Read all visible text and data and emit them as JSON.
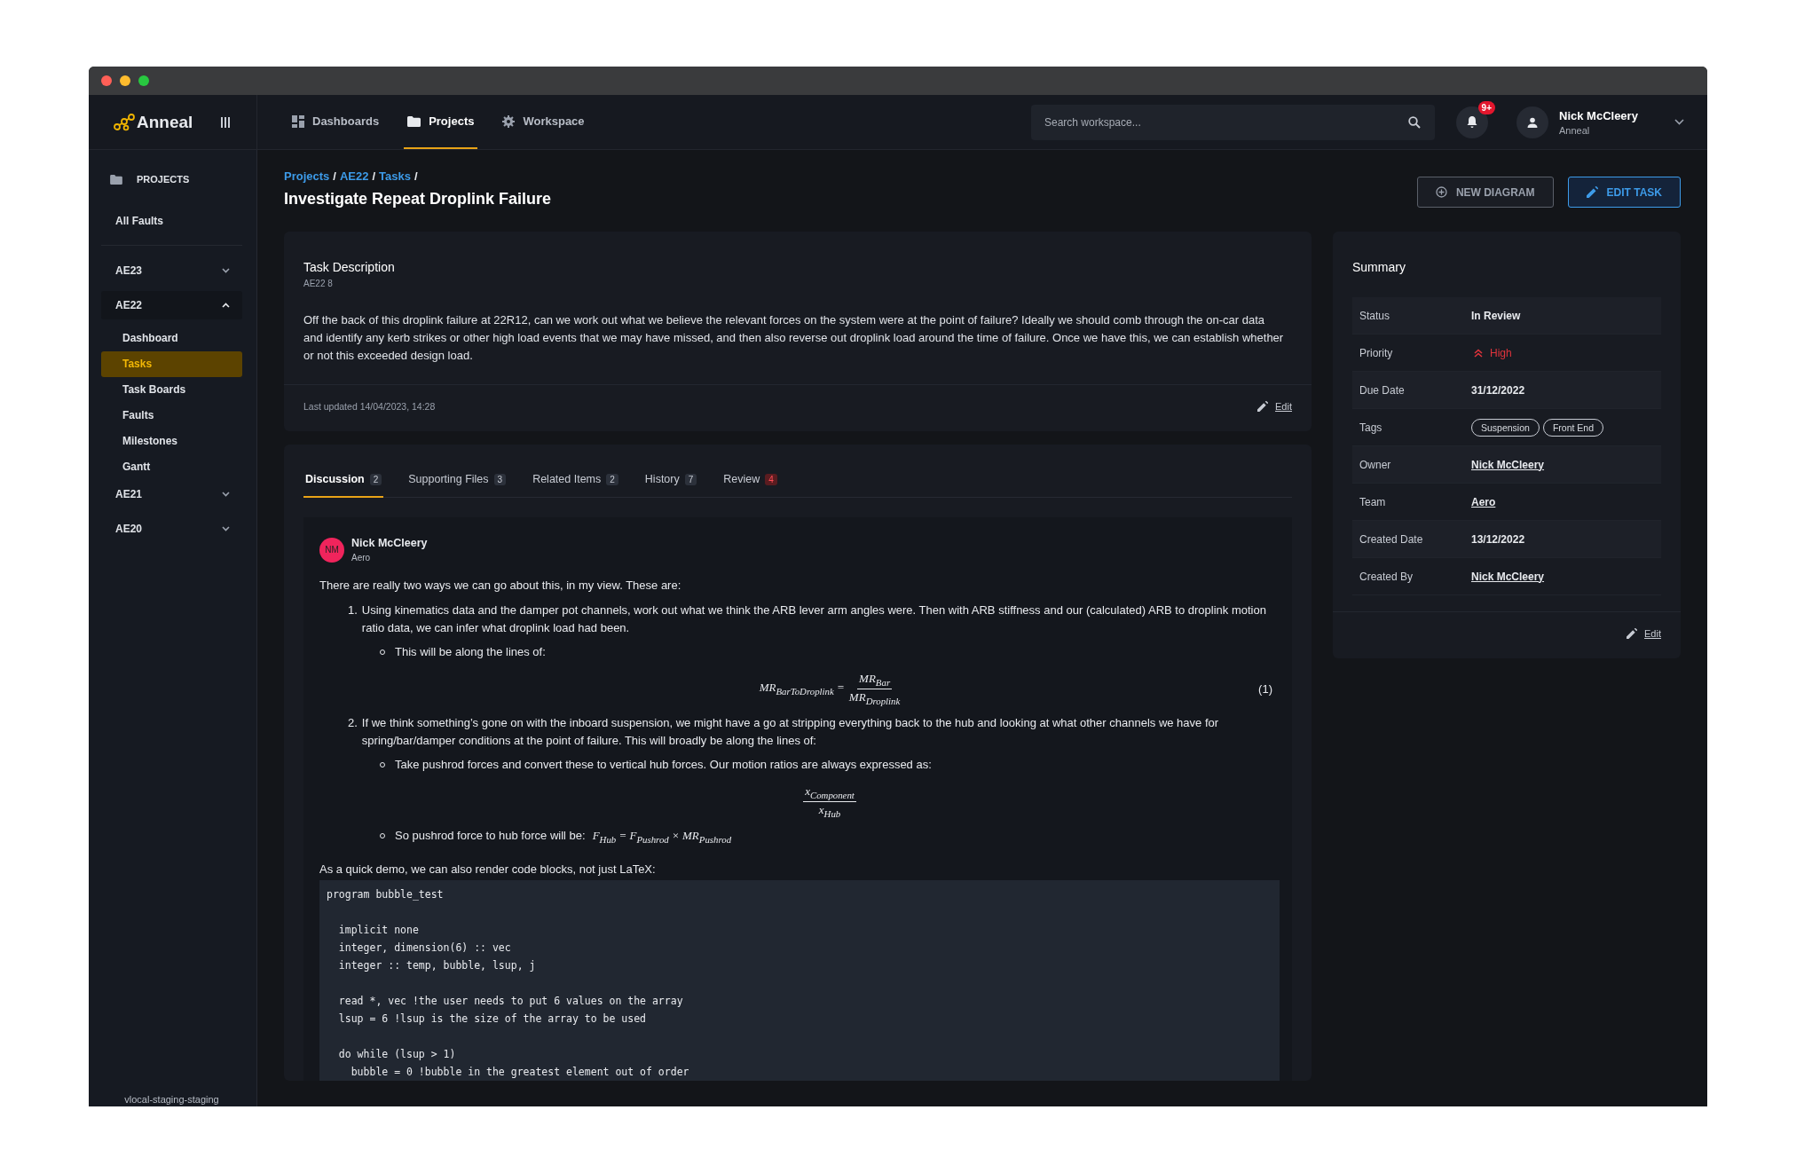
{
  "app": {
    "name": "Anneal"
  },
  "nav": [
    {
      "label": "Dashboards",
      "selected": false
    },
    {
      "label": "Projects",
      "selected": true
    },
    {
      "label": "Workspace",
      "selected": false
    }
  ],
  "search": {
    "placeholder": "Search workspace..."
  },
  "notifications": {
    "badge": "9+"
  },
  "user": {
    "name": "Nick McCleery",
    "org": "Anneal"
  },
  "sidebar": {
    "heading": "PROJECTS",
    "top_item": "All Faults",
    "groups": [
      {
        "label": "AE23",
        "expanded": false
      },
      {
        "label": "AE22",
        "expanded": true,
        "children": [
          {
            "label": "Dashboard",
            "selected": false
          },
          {
            "label": "Tasks",
            "selected": true
          },
          {
            "label": "Task Boards",
            "selected": false
          },
          {
            "label": "Faults",
            "selected": false
          },
          {
            "label": "Milestones",
            "selected": false
          },
          {
            "label": "Gantt",
            "selected": false
          }
        ]
      },
      {
        "label": "AE21",
        "expanded": false
      },
      {
        "label": "AE20",
        "expanded": false
      }
    ],
    "footer": "vlocal-staging-staging"
  },
  "breadcrumb": [
    {
      "label": "Projects",
      "sep": "/"
    },
    {
      "label": "AE22",
      "sep": "/"
    },
    {
      "label": "Tasks",
      "sep": "/"
    }
  ],
  "title": "Investigate Repeat Droplink Failure",
  "actions": [
    {
      "label": "NEW DIAGRAM",
      "kind": "outline"
    },
    {
      "label": "EDIT TASK",
      "kind": "primary"
    }
  ],
  "description": {
    "title": "Task Description",
    "ref": "AE22 8",
    "body": "Off the back of this droplink failure at 22R12, can we work out what we believe the relevant forces on the system were at the point of failure? Ideally we should comb through the on-car data and identify any kerb strikes or other high load events that we may have missed, and then also reverse out droplink load around the time of failure. Once we have this, we can establish whether or not this exceeded design load.",
    "updated": "Last updated 14/04/2023, 14:28",
    "edit": "Edit"
  },
  "tabs": [
    {
      "label": "Discussion",
      "count": "2",
      "selected": true,
      "alert": false
    },
    {
      "label": "Supporting Files",
      "count": "3",
      "selected": false,
      "alert": false
    },
    {
      "label": "Related Items",
      "count": "2",
      "selected": false,
      "alert": false
    },
    {
      "label": "History",
      "count": "7",
      "selected": false,
      "alert": false
    },
    {
      "label": "Review",
      "count": "4",
      "selected": false,
      "alert": true
    }
  ],
  "comment": {
    "initials": "NM",
    "author": "Nick McCleery",
    "team": "Aero",
    "intro": "There are really two ways we can go about this, in my view. These are:",
    "points": [
      {
        "number": "1.",
        "text": "Using kinematics data and the damper pot channels, work out what we think the ARB lever arm angles were. Then with ARB stiffness and our (calculated) ARB to droplink motion ratio data, we can infer what droplink load had been.",
        "bullets": [
          {
            "text": "This will be along the lines of:",
            "display": {
              "lhs": "MR$_{BarToDroplink}$ =",
              "numerator": "MR$_{Bar}$",
              "denominator": "MR$_{Droplink}$",
              "number": "(1)"
            }
          }
        ]
      },
      {
        "number": "2.",
        "text": "If we think something’s gone on with the inboard suspension, we might have a go at stripping everything back to the hub and looking at what other channels we have for spring/bar/damper conditions at the point of failure. This will broadly be along the lines of:",
        "bullets": [
          {
            "text": "Take pushrod forces and convert these to vertical hub forces. Our motion ratios are always expressed as:",
            "display": {
              "numerator": "x$_{Component}$",
              "denominator": "x$_{Hub}$"
            }
          },
          {
            "text": "So pushrod force to hub force will be:",
            "inline_math": "F$_{Hub}$ = F$_{Pushrod}$ × MR$_{Pushrod}$"
          }
        ]
      }
    ],
    "code_intro": "As a quick demo, we can also render code blocks, not just LaTeX:",
    "code": [
      [
        "program bubble_test"
      ],
      [
        "  implicit none",
        "  integer, dimension(6) :: vec",
        "  integer :: temp, bubble, lsup, j"
      ],
      [
        "  read *, vec !the user needs to put 6 values on the array",
        "  lsup = 6 !lsup is the size of the array to be used"
      ],
      [
        "  do while (lsup > 1)",
        "    bubble = 0 !bubble in the greatest element out of order"
      ]
    ]
  },
  "summary": {
    "title": "Summary",
    "rows": [
      {
        "label": "Status",
        "value": "In Review",
        "kind": "text"
      },
      {
        "label": "Priority",
        "value": "High",
        "kind": "priority"
      },
      {
        "label": "Due Date",
        "value": "31/12/2022",
        "kind": "text"
      },
      {
        "label": "Tags",
        "tags": [
          "Suspension",
          "Front End"
        ],
        "kind": "tags"
      },
      {
        "label": "Owner",
        "value": "Nick McCleery",
        "kind": "link"
      },
      {
        "label": "Team",
        "value": "Aero",
        "kind": "link"
      },
      {
        "label": "Created Date",
        "value": "13/12/2022",
        "kind": "text"
      },
      {
        "label": "Created By",
        "value": "Nick McCleery",
        "kind": "link"
      }
    ],
    "edit": "Edit"
  }
}
